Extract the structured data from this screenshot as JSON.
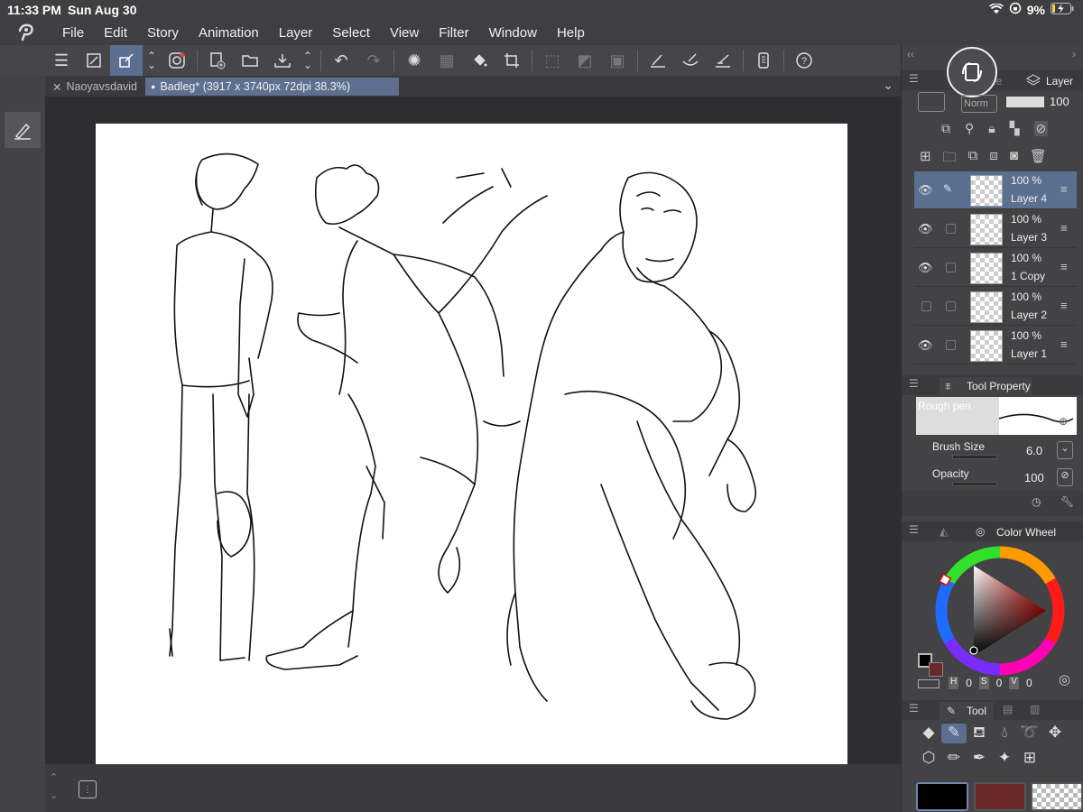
{
  "status": {
    "time": "11:33 PM",
    "date": "Sun Aug 30",
    "battery": "9%"
  },
  "menu": [
    "File",
    "Edit",
    "Story",
    "Animation",
    "Layer",
    "Select",
    "View",
    "Filter",
    "Window",
    "Help"
  ],
  "tabs": [
    {
      "label": "Naoyavsdavid",
      "close": "✕"
    },
    {
      "label": "Badleg* (3917 x 3740px 72dpi 38.3%)",
      "marker": "●"
    }
  ],
  "layer_panel": {
    "title": "Layer",
    "size_tab": "Size",
    "blend_mode": "Norm",
    "opacity": "100",
    "layers": [
      {
        "pct": "100 %",
        "name": "Layer 4",
        "visible": true,
        "selected": true
      },
      {
        "pct": "100 %",
        "name": "Layer 3",
        "visible": true,
        "selected": false
      },
      {
        "pct": "100 %",
        "name": "1 Copy",
        "visible": true,
        "selected": false
      },
      {
        "pct": "100 %",
        "name": "Layer 2",
        "visible": false,
        "selected": false
      },
      {
        "pct": "100 %",
        "name": "Layer 1",
        "visible": true,
        "selected": false
      }
    ]
  },
  "tool_property": {
    "title": "Tool Property",
    "brush_name": "Rough pen",
    "brush_size_label": "Brush Size",
    "brush_size": "6.0",
    "opacity_label": "Opacity",
    "opacity": "100"
  },
  "color_wheel": {
    "title": "Color Wheel",
    "h": "0",
    "s": "0",
    "v": "0",
    "h_label": "H",
    "s_label": "S",
    "v_label": "V"
  },
  "tool_panel": {
    "title": "Tool"
  },
  "colors": {
    "accent": "#5b6f91",
    "main_color": "#000000",
    "sub_color": "#6b2a2a"
  }
}
